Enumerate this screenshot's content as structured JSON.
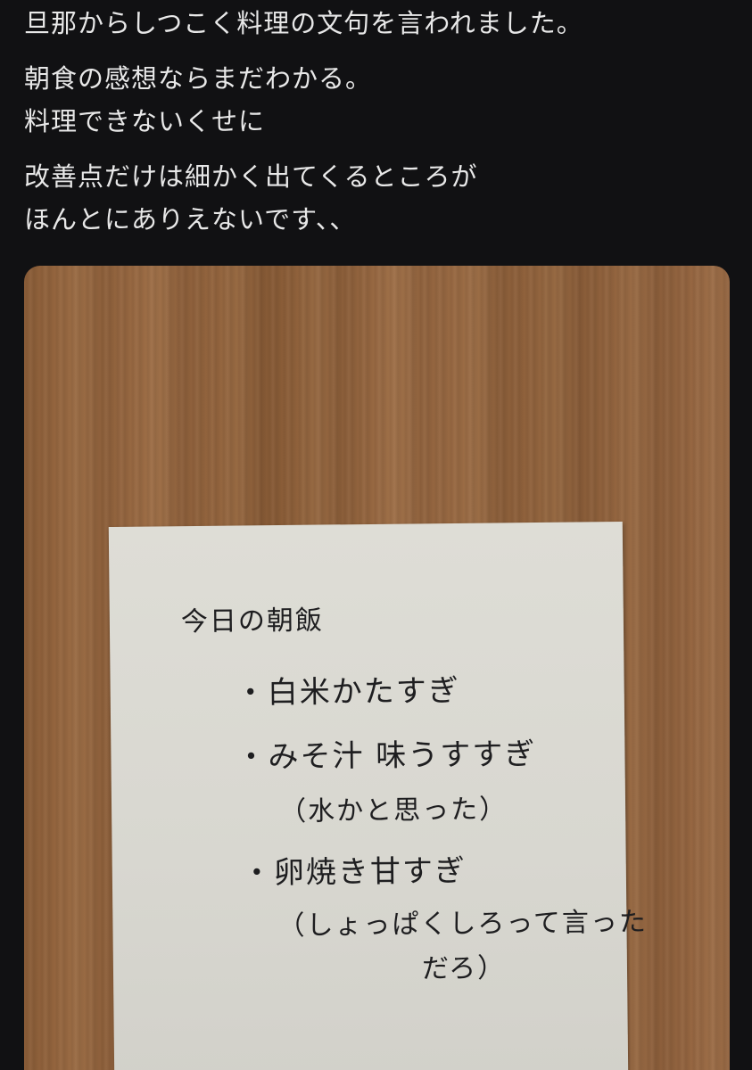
{
  "post": {
    "lines": [
      "旦那からしつこく料理の文句を言われました。",
      "朝食の感想ならまだわかる。",
      "料理できないくせに",
      "改善点だけは細かく出てくるところが",
      "ほんとにありえないです、、"
    ]
  },
  "note": {
    "title": "今日の朝飯",
    "items": [
      "・白米かたすぎ",
      "・みそ汁 味うすすぎ",
      "（水かと思った）",
      "・卵焼き甘すぎ",
      "（しょっぱくしろって言った",
      "だろ）"
    ]
  }
}
